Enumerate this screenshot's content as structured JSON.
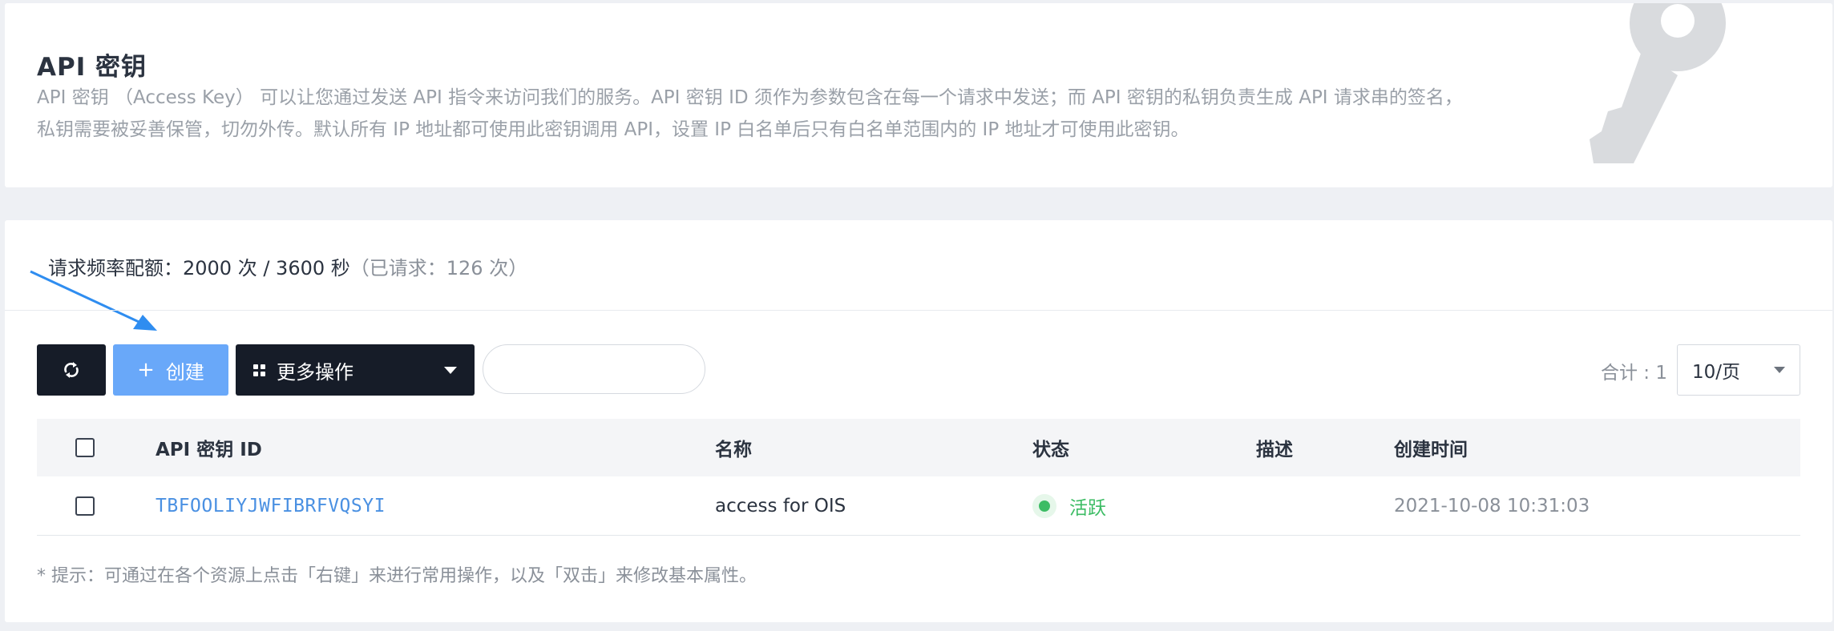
{
  "header": {
    "title": "API 密钥",
    "description": "API 密钥 （Access Key） 可以让您通过发送 API 指令来访问我们的服务。API 密钥 ID 须作为参数包含在每一个请求中发送；而 API 密钥的私钥负责生成 API 请求串的签名，私钥需要被妥善保管，切勿外传。默认所有 IP 地址都可使用此密钥调用 API，设置 IP 白名单后只有白名单范围内的 IP 地址才可使用此密钥。"
  },
  "quota": {
    "label": "请求频率配额：2000 次 / 3600 秒",
    "used": "（已请求：126 次）"
  },
  "toolbar": {
    "create_label": "创建",
    "more_label": "更多操作",
    "search_placeholder": "",
    "total_label": "合计 : 1",
    "page_size": "10/页"
  },
  "table": {
    "columns": [
      "API 密钥 ID",
      "名称",
      "状态",
      "描述",
      "创建时间"
    ],
    "rows": [
      {
        "id": "TBFOOLIYJWFIBRFVQSYI",
        "name": "access for OIS",
        "status": "活跃",
        "description": "",
        "created": "2021-10-08 10:31:03"
      }
    ]
  },
  "tip": "* 提示：可通过在各个资源上点击「右键」来进行常用操作，以及「双击」来修改基本属性。",
  "colors": {
    "primary_dark": "#161c28",
    "create_blue": "#69a8f9",
    "link_blue": "#4a90e2",
    "status_green": "#3cbc64"
  }
}
